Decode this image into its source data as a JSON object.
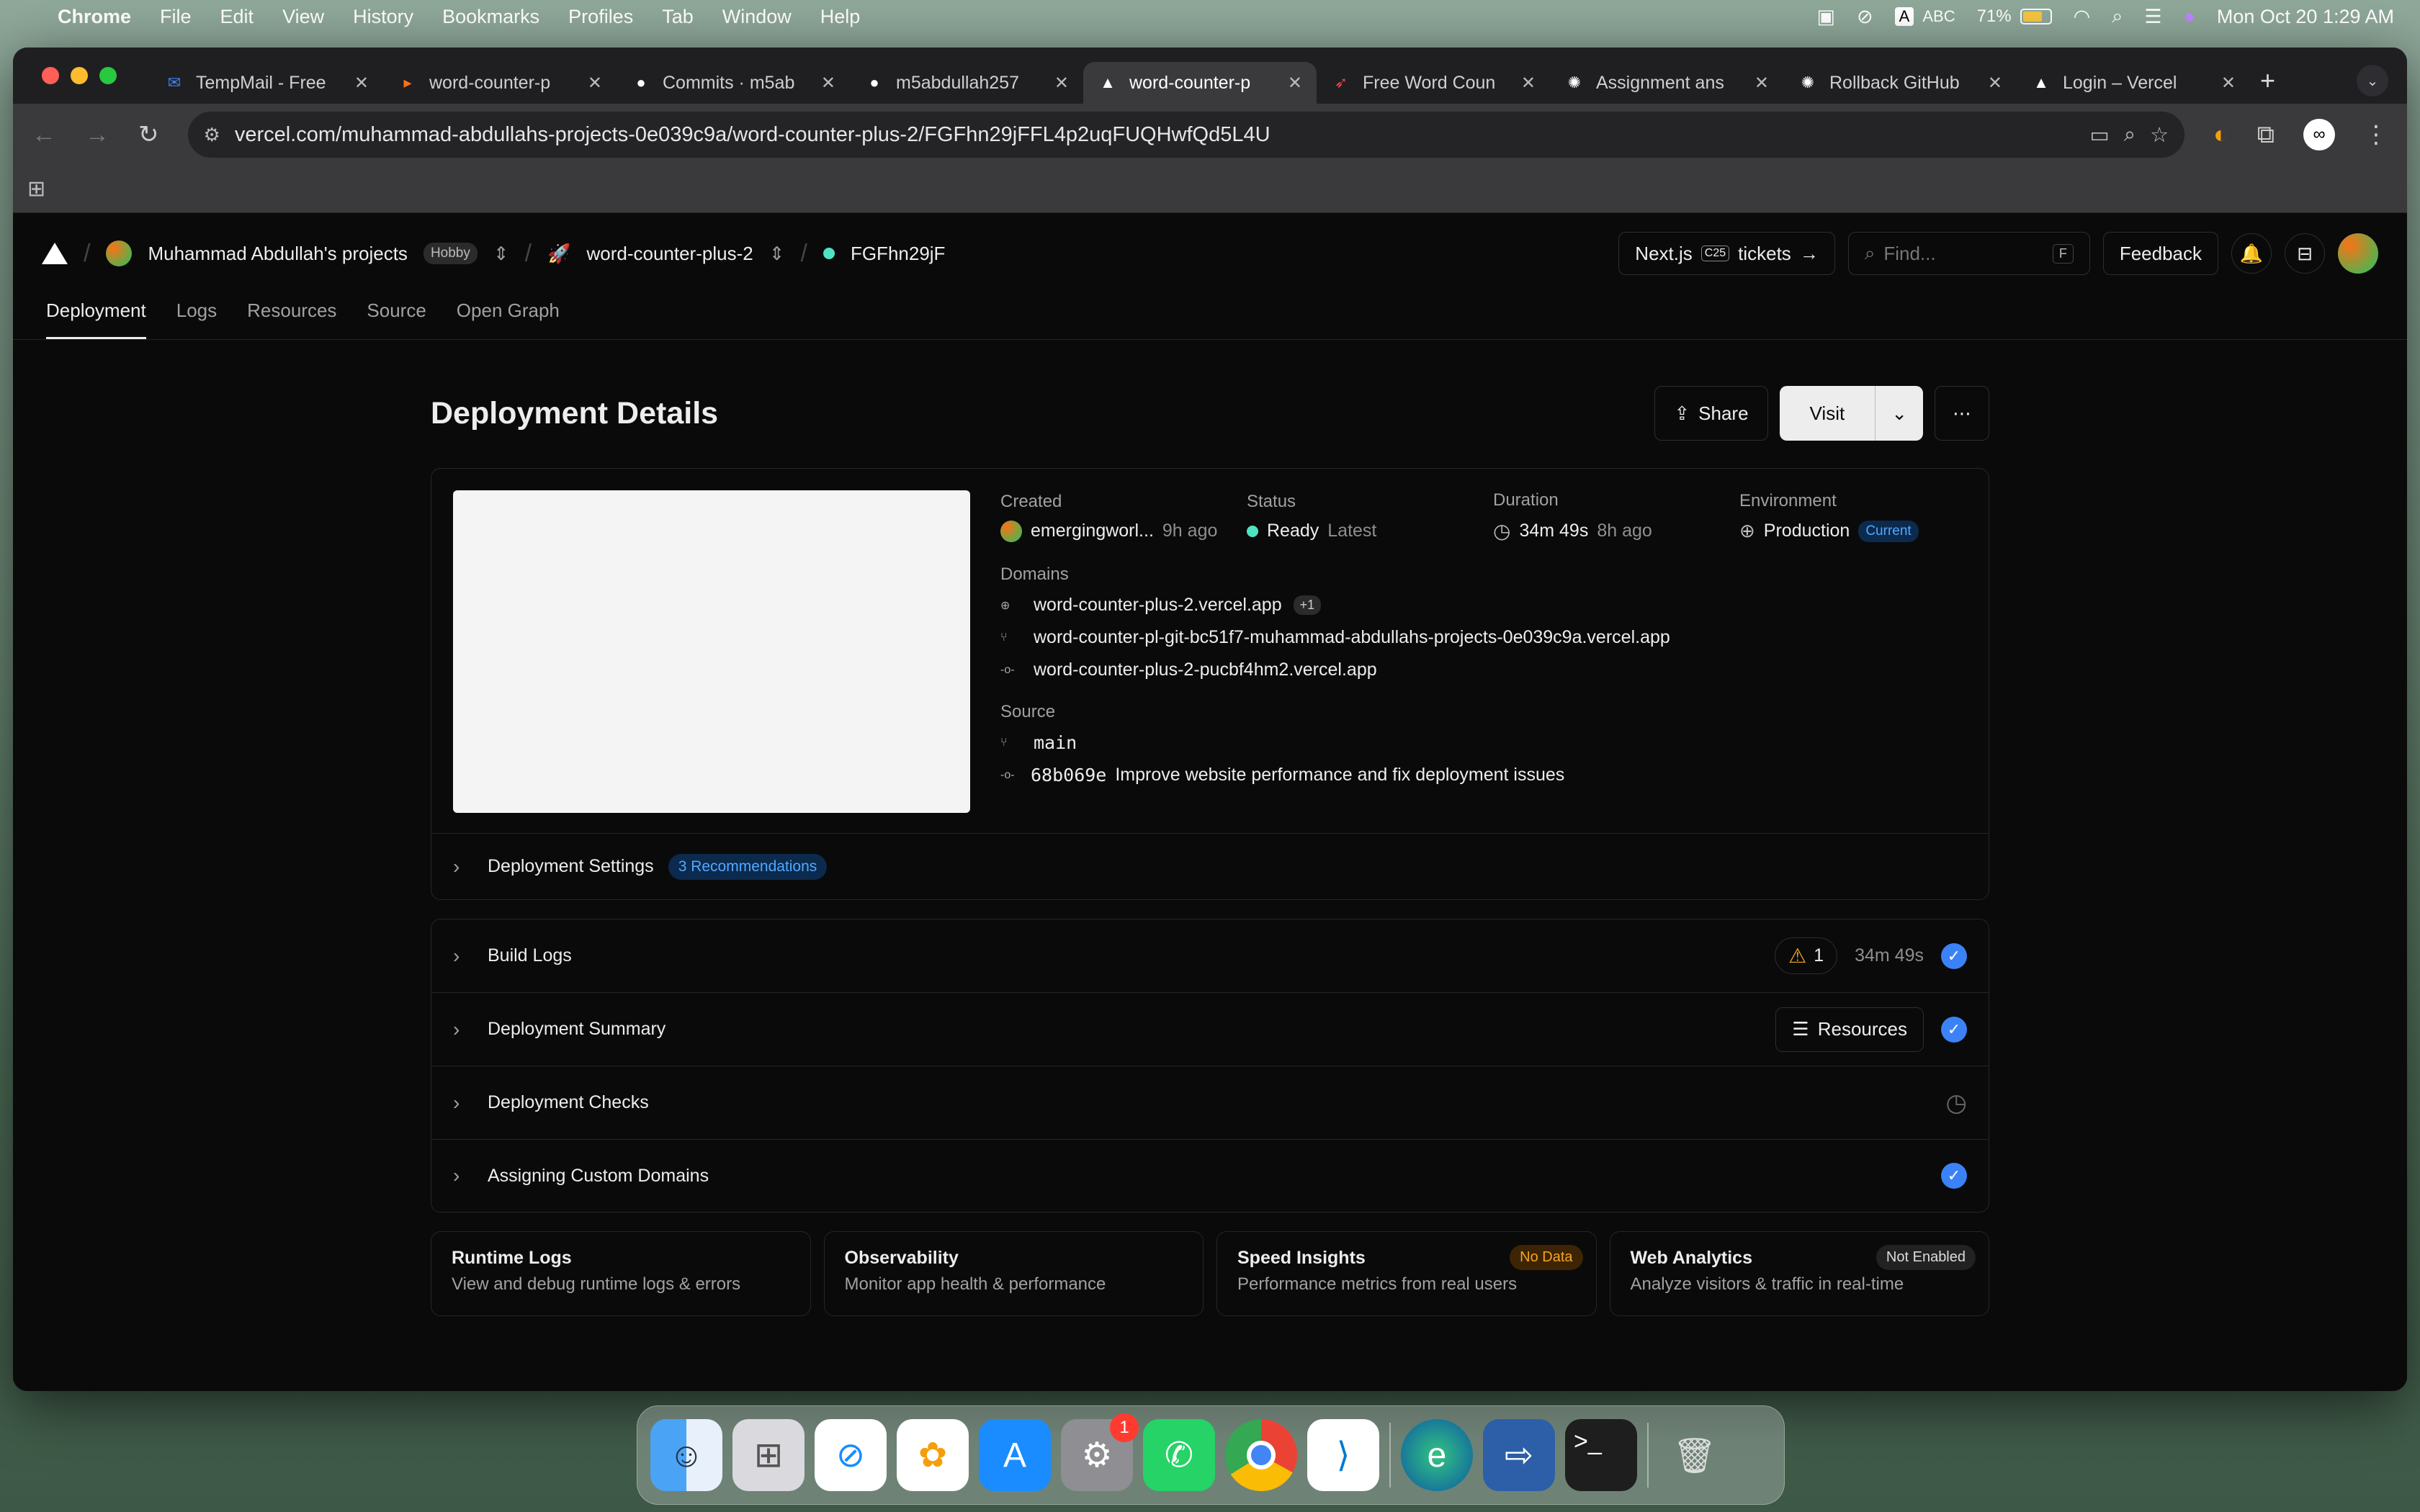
{
  "menubar": {
    "app": "Chrome",
    "items": [
      "File",
      "Edit",
      "View",
      "History",
      "Bookmarks",
      "Profiles",
      "Tab",
      "Window",
      "Help"
    ],
    "input_source": "ABC",
    "battery": "71%",
    "datetime": "Mon Oct 20  1:29 AM"
  },
  "tabs": [
    {
      "title": "TempMail - Free",
      "icon": "mail-icon",
      "color": "#3b82f6"
    },
    {
      "title": "word-counter-p",
      "icon": "cursor-icon",
      "color": "#f97316"
    },
    {
      "title": "Commits · m5ab",
      "icon": "github-icon",
      "color": "#ffffff"
    },
    {
      "title": "m5abdullah257",
      "icon": "github-icon",
      "color": "#ffffff"
    },
    {
      "title": "word-counter-p",
      "icon": "vercel-icon",
      "color": "#ffffff",
      "active": true
    },
    {
      "title": "Free Word Coun",
      "icon": "rocket-icon",
      "color": "#ef4444"
    },
    {
      "title": "Assignment ans",
      "icon": "openai-icon",
      "color": "#ffffff"
    },
    {
      "title": "Rollback GitHub",
      "icon": "openai-icon",
      "color": "#ffffff"
    },
    {
      "title": "Login – Vercel",
      "icon": "vercel-icon",
      "color": "#ffffff"
    }
  ],
  "url": "vercel.com/muhammad-abdullahs-projects-0e039c9a/word-counter-plus-2/FGFhn29jFFL4p2uqFUQHwfQd5L4U",
  "header": {
    "team": "Muhammad Abdullah's projects",
    "plan": "Hobby",
    "project": "word-counter-plus-2",
    "deployment": "FGFhn29jF",
    "promo_a": "Next.js",
    "promo_badge": "C25",
    "promo_b": "tickets",
    "find_placeholder": "Find...",
    "find_key": "F",
    "feedback": "Feedback"
  },
  "nav": [
    "Deployment",
    "Logs",
    "Resources",
    "Source",
    "Open Graph"
  ],
  "page_title": "Deployment Details",
  "actions": {
    "share": "Share",
    "visit": "Visit"
  },
  "details": {
    "created_label": "Created",
    "created_by": "emergingworl...",
    "created_ago": "9h ago",
    "status_label": "Status",
    "status": "Ready",
    "status_tag": "Latest",
    "duration_label": "Duration",
    "duration": "34m 49s",
    "duration_ago": "8h ago",
    "env_label": "Environment",
    "env": "Production",
    "env_badge": "Current",
    "domains_label": "Domains",
    "domain1": "word-counter-plus-2.vercel.app",
    "domain1_more": "+1",
    "domain2": "word-counter-pl-git-bc51f7-muhammad-abdullahs-projects-0e039c9a.vercel.app",
    "domain3": "word-counter-plus-2-pucbf4hm2.vercel.app",
    "source_label": "Source",
    "branch": "main",
    "commit_hash": "68b069e",
    "commit_msg": "Improve website performance and fix deployment issues"
  },
  "settings": {
    "label": "Deployment Settings",
    "badge": "3 Recommendations"
  },
  "sections": {
    "build_logs": "Build Logs",
    "build_warnings": "1",
    "build_duration": "34m 49s",
    "summary": "Deployment Summary",
    "summary_btn": "Resources",
    "checks": "Deployment Checks",
    "domains": "Assigning Custom Domains"
  },
  "bottom_cards": [
    {
      "title": "Runtime Logs",
      "desc": "View and debug runtime logs & errors",
      "badge": ""
    },
    {
      "title": "Observability",
      "desc": "Monitor app health & performance",
      "badge": ""
    },
    {
      "title": "Speed Insights",
      "desc": "Performance metrics from real users",
      "badge": "No Data"
    },
    {
      "title": "Web Analytics",
      "desc": "Analyze visitors & traffic in real-time",
      "badge": "Not Enabled"
    }
  ],
  "dock": {
    "settings_badge": "1"
  }
}
